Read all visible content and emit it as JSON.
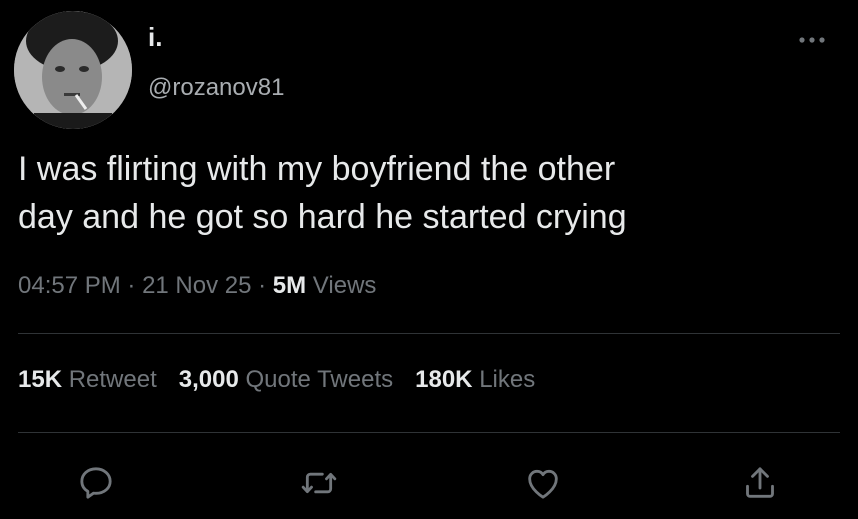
{
  "user": {
    "display_name": "i.",
    "handle": "@rozanov81",
    "avatar_icon": "profile-photo"
  },
  "tweet": {
    "text_line1": "I was flirting with my boyfriend the other",
    "text_line2": "day and he got so hard he started crying"
  },
  "meta": {
    "time": "04:57 PM",
    "sep1": " · ",
    "date": "21 Nov 25",
    "sep2": " · ",
    "views_count": "5M",
    "views_label": " Views"
  },
  "stats": {
    "retweets_count": "15K",
    "retweets_label": "Retweet",
    "quotes_count": "3,000",
    "quotes_label": "Quote Tweets",
    "likes_count": "180K",
    "likes_label": "Likes"
  },
  "actions": {
    "reply_icon": "reply-icon",
    "retweet_icon": "retweet-icon",
    "like_icon": "heart-icon",
    "share_icon": "share-icon"
  },
  "colors": {
    "background": "#000000",
    "primary_text": "#e7e9ea",
    "secondary_text": "#71767b",
    "divider": "#2f3336"
  }
}
